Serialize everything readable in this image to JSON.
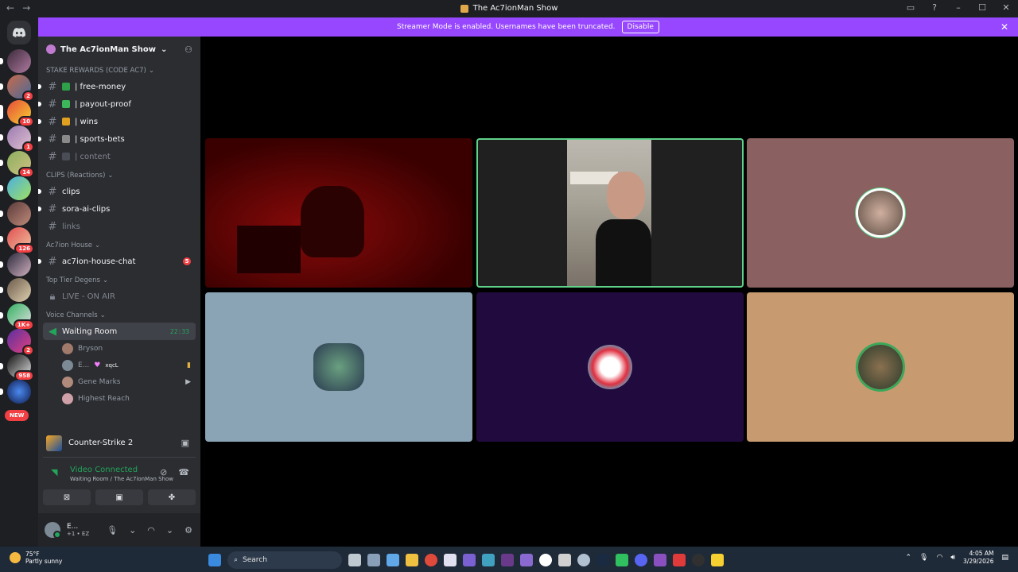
{
  "window": {
    "title": "The Ac7ionMan Show",
    "nav_back": "←",
    "nav_forward": "→",
    "controls": [
      "inbox-icon",
      "help-icon",
      "minimize-icon",
      "maximize-icon",
      "close-icon"
    ]
  },
  "banner": {
    "text": "Streamer Mode is enabled. Usernames have been truncated.",
    "button": "Disable",
    "close": "✕",
    "color": "#9747ff"
  },
  "guilds": {
    "badges": [
      "2",
      "10",
      "1",
      "14",
      "126",
      "1K+",
      "2",
      "958"
    ],
    "new_label": "NEW"
  },
  "server": {
    "name": "The Ac7ionMan Show"
  },
  "categories": {
    "stake": "STAKE REWARDS (CODE AC7)",
    "clips": "CLIPS (Reactions)",
    "house": "Ac7ion House",
    "degens": "Top Tier Degens",
    "voice": "Voice Channels"
  },
  "channels": {
    "free_money": "| free-money",
    "payout_proof": "| payout-proof",
    "wins": "| wins",
    "sports_bets": "| sports-bets",
    "content": "| content",
    "clips": "clips",
    "sora": "sora-ai-clips",
    "links": "links",
    "house_chat": "ac7ion-house-chat",
    "house_chat_mentions": "5",
    "live": "LIVE - ON AIR",
    "waiting_room": "Waiting Room",
    "waiting_timer": "22:33"
  },
  "members": {
    "m1": "Bryson",
    "m2": "E...",
    "m2_tag": "xqcL",
    "m3": "Gene Marks",
    "m4": "Highest Reach"
  },
  "activity": {
    "game": "Counter-Strike 2"
  },
  "voice": {
    "status": "Video Connected",
    "location": "Waiting Room / The Ac7ionMan Show"
  },
  "user": {
    "name": "E...",
    "status": "+1 • EZ"
  },
  "taskbar": {
    "temp": "75°F",
    "condition": "Partly sunny",
    "search": "Search",
    "time": "4:05 AM",
    "date": "3/29/2026"
  }
}
